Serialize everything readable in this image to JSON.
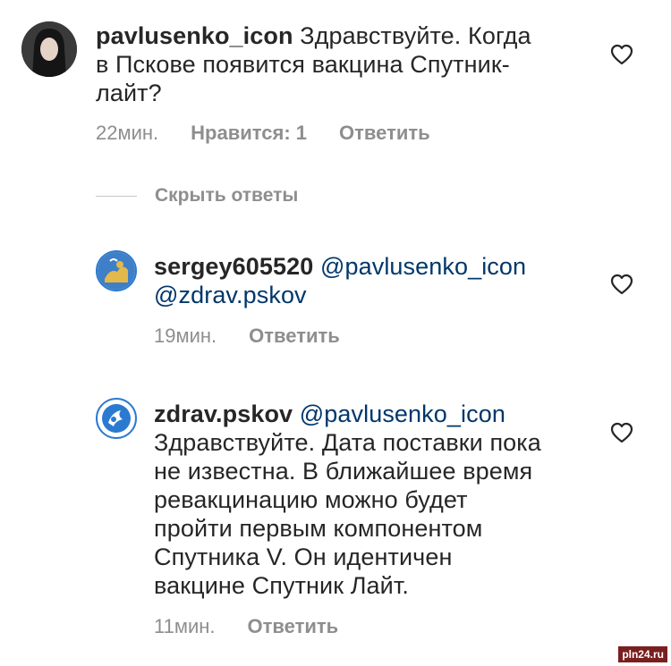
{
  "comments": [
    {
      "username": "pavlusenko_icon",
      "text_lines": [
        "Здравствуйте. Когда",
        "в Пскове появится вакцина Спутник-",
        "лайт?"
      ],
      "time": "22мин.",
      "likes": "Нравится: 1",
      "reply_label": "Ответить",
      "avatar_icon": "profile-photo"
    },
    {
      "username": "sergey605520",
      "mention1": "@pavlusenko_icon",
      "mention2": "@zdrav.pskov",
      "time": "19мин.",
      "reply_label": "Ответить",
      "avatar_icon": "pskov-emblem"
    },
    {
      "username": "zdrav.pskov",
      "mention1": "@pavlusenko_icon",
      "text_lines": [
        "Здравствуйте. Дата поставки пока",
        "не известна. В ближайшее время",
        "ревакцинацию можно будет",
        "пройти первым компонентом",
        "Спутника V. Он идентичен",
        "вакцине Спутник Лайт."
      ],
      "time": "11мин.",
      "reply_label": "Ответить",
      "avatar_icon": "health-logo"
    }
  ],
  "hide_replies_label": "Скрыть ответы",
  "watermark": "pln24.ru",
  "colors": {
    "text": "#262626",
    "meta": "#8e8e8e",
    "mention": "#00376b",
    "accent_blue": "#2b7ad1"
  }
}
